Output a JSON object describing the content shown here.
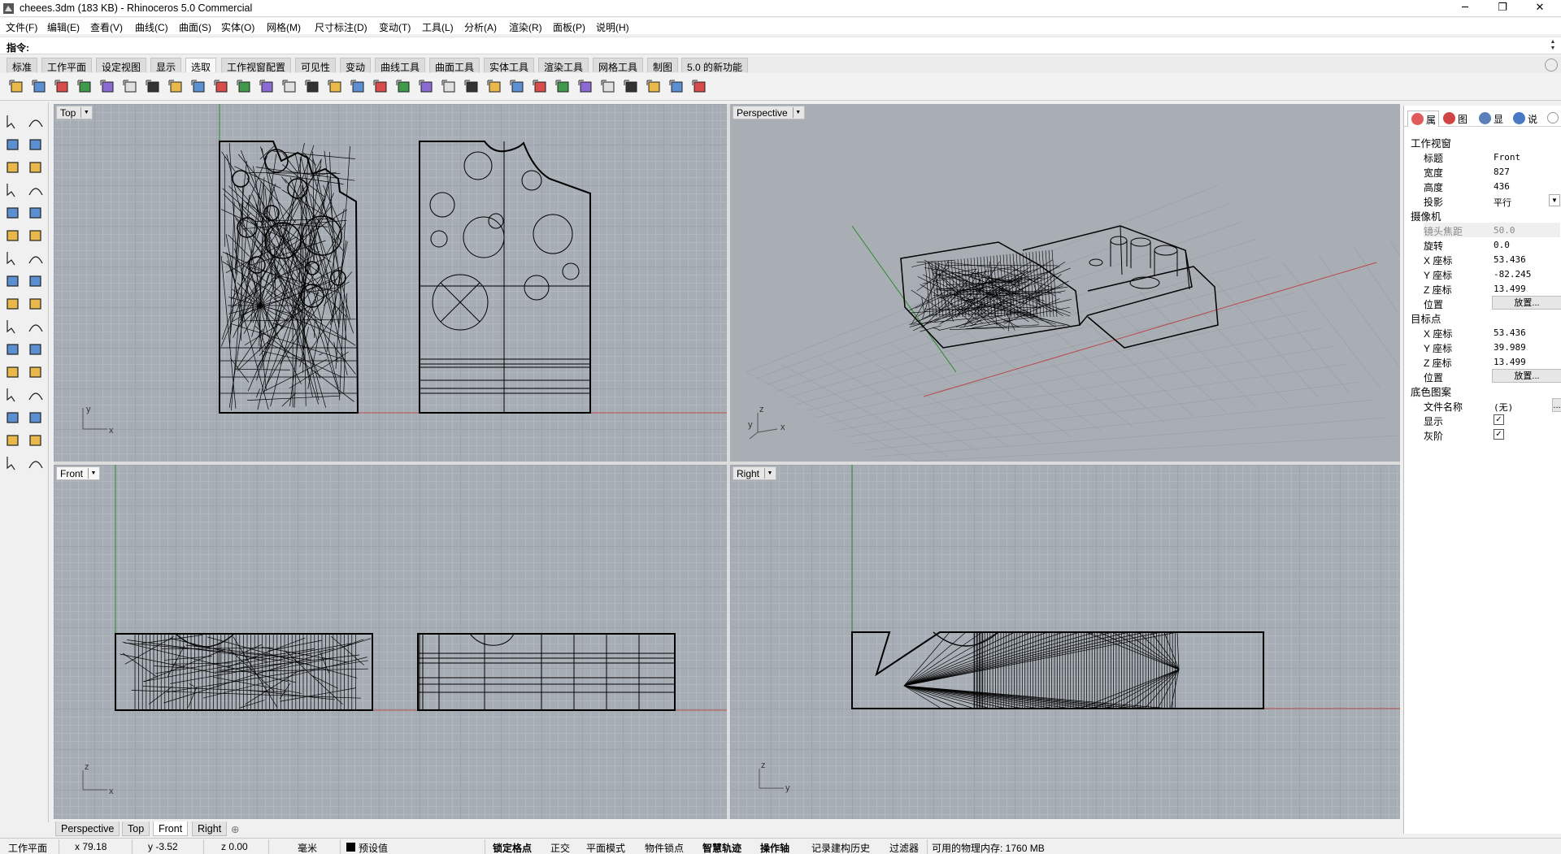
{
  "window": {
    "title": "cheees.3dm (183 KB) - Rhinoceros 5.0 Commercial",
    "minimize_glyph": "─",
    "restore_glyph": "❐",
    "close_glyph": "✕"
  },
  "menu": [
    "文件(F)",
    "编辑(E)",
    "查看(V)",
    "曲线(C)",
    "曲面(S)",
    "实体(O)",
    "网格(M)",
    "尺寸标注(D)",
    "变动(T)",
    "工具(L)",
    "分析(A)",
    "渲染(R)",
    "面板(P)",
    "说明(H)"
  ],
  "command": {
    "label": "指令:",
    "value": ""
  },
  "toolbar_tabs": [
    "标准",
    "工作平面",
    "设定视图",
    "显示",
    "选取",
    "工作视窗配置",
    "可见性",
    "变动",
    "曲线工具",
    "曲面工具",
    "实体工具",
    "渲染工具",
    "网格工具",
    "制图",
    "5.0 的新功能"
  ],
  "active_toolbar_tab": "选取",
  "toolbar_icons": [
    "select-all-icon",
    "select-none-icon",
    "select-curves-icon",
    "select-surfaces-icon",
    "select-polysurfaces-icon",
    "select-lights-icon",
    "select-annotations-icon",
    "select-blocks-icon",
    "select-color-icon",
    "select-layer-icon",
    "select-points-icon",
    "select-meshes-icon",
    "select-previous-icon",
    "select-last-icon",
    "select-duplicates-icon",
    "select-chain-icon",
    "select-open-icon",
    "select-closed-icon",
    "select-lines-icon",
    "select-polylines-icon",
    "select-arcs-icon",
    "select-circles-icon",
    "select-bad-objects-icon",
    "select-small-icon",
    "select-render-icon",
    "select-hatch-icon",
    "select-dots-icon",
    "select-pointclouds-icon",
    "select-history-icon",
    "select-name-icon",
    "filter-icon"
  ],
  "left_tools": [
    "select-arrow-icon",
    "point-icon",
    "polyline-icon",
    "curve-icon",
    "circle-icon",
    "arc-icon",
    "polygon-icon",
    "rectangle-icon",
    "ellipse-icon",
    "freeform-icon",
    "surface-from-points-icon",
    "surface-edge-icon",
    "box-solid-icon",
    "sphere-icon",
    "extrude-icon",
    "patch-icon",
    "boolean-icon",
    "explode-icon",
    "fillet-icon",
    "extend-icon",
    "sweep-icon",
    "loft-icon",
    "text-icon",
    "dimension-icon",
    "mirror-icon",
    "move-icon",
    "array-icon",
    "group-icon",
    "analyze-icon",
    "check-icon",
    "render-icon",
    "material-icon"
  ],
  "viewports": [
    {
      "name": "Top",
      "axis_a": "y",
      "axis_b": "x"
    },
    {
      "name": "Perspective",
      "axis_a": "z",
      "axis_b": "x",
      "axis_c": "y"
    },
    {
      "name": "Front",
      "axis_a": "z",
      "axis_b": "x"
    },
    {
      "name": "Right",
      "axis_a": "z",
      "axis_b": "y"
    }
  ],
  "active_viewport": "Front",
  "viewport_tabs": [
    "Perspective",
    "Top",
    "Front",
    "Right",
    "⊕"
  ],
  "panel": {
    "tabs": [
      {
        "label": "属",
        "icon": "properties-icon",
        "color": "#e25b5b"
      },
      {
        "label": "图",
        "icon": "layers-icon",
        "color": "#d04444"
      },
      {
        "label": "显",
        "icon": "display-icon",
        "color": "#5b7fb8"
      },
      {
        "label": "说",
        "icon": "help-icon",
        "color": "#4978c4"
      }
    ],
    "gear_icon": "panel-gear-icon",
    "sections": {
      "viewport": "工作视窗",
      "camera": "摄像机",
      "target": "目标点",
      "wallpaper": "底色图案"
    },
    "viewport_rows": [
      {
        "key": "标题",
        "value": "Front"
      },
      {
        "key": "宽度",
        "value": "827"
      },
      {
        "key": "高度",
        "value": "436"
      },
      {
        "key": "投影",
        "value": "平行"
      }
    ],
    "camera_rows": [
      {
        "key": "镜头焦距",
        "value": "50.0"
      },
      {
        "key": "旋转",
        "value": "0.0"
      },
      {
        "key": "X 座标",
        "value": "53.436"
      },
      {
        "key": "Y 座标",
        "value": "-82.245"
      },
      {
        "key": "Z 座标",
        "value": "13.499"
      },
      {
        "key": "位置",
        "button": "放置..."
      }
    ],
    "target_rows": [
      {
        "key": "X 座标",
        "value": "53.436"
      },
      {
        "key": "Y 座标",
        "value": "39.989"
      },
      {
        "key": "Z 座标",
        "value": "13.499"
      },
      {
        "key": "位置",
        "button": "放置..."
      }
    ],
    "wallpaper_rows": [
      {
        "key": "文件名称",
        "value": "(无)",
        "button": "..."
      },
      {
        "key": "显示",
        "checked": true
      },
      {
        "key": "灰阶",
        "checked": true
      }
    ]
  },
  "status": {
    "cplane": "工作平面",
    "x": "x 79.18",
    "y": "y -3.52",
    "z": "z 0.00",
    "units": "毫米",
    "layer": "预设值",
    "snap": "锁定格点",
    "ortho": "正交",
    "planar": "平面模式",
    "osnap": "物件锁点",
    "smarttrack": "智慧轨迹",
    "gumball": "操作轴",
    "history": "记录建构历史",
    "filter": "过滤器",
    "memory": "可用的物理内存: 1760 MB"
  }
}
